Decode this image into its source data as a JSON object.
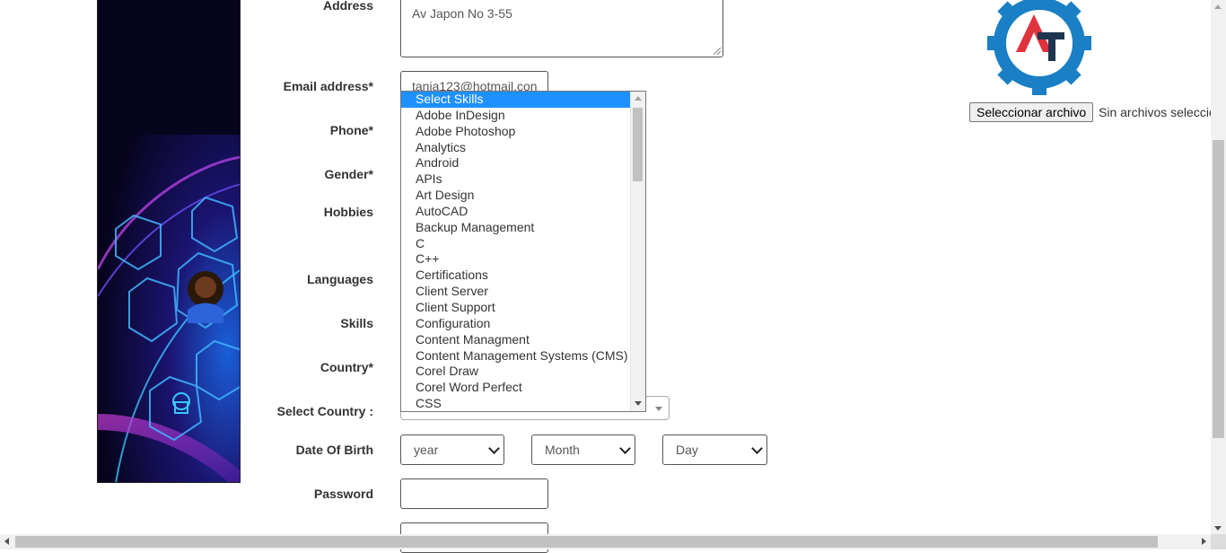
{
  "form": {
    "labels": {
      "address": "Address",
      "email": "Email address*",
      "phone": "Phone*",
      "gender": "Gender*",
      "hobbies": "Hobbies",
      "languages": "Languages",
      "skills": "Skills",
      "country": "Country*",
      "select_country": "Select Country :",
      "dob": "Date Of Birth",
      "password": "Password"
    },
    "address_value": "Av Japon No 3-55",
    "email_value": "tania123@hotmail.con",
    "dob": {
      "year": "year",
      "month": "Month",
      "day": "Day"
    }
  },
  "skills_dropdown": {
    "selected": "Select Skills",
    "options": [
      "Select Skills",
      "Adobe InDesign",
      "Adobe Photoshop",
      "Analytics",
      "Android",
      "APIs",
      "Art Design",
      "AutoCAD",
      "Backup Management",
      "C",
      "C++",
      "Certifications",
      "Client Server",
      "Client Support",
      "Configuration",
      "Content Managment",
      "Content Management Systems (CMS)",
      "Corel Draw",
      "Corel Word Perfect",
      "CSS"
    ]
  },
  "upload": {
    "button_label": "Seleccionar archivo",
    "status_text": "Sin archivos seleccionados"
  },
  "colors": {
    "selected_option": "#1e90ff",
    "logo_blue": "#1a7fc4",
    "logo_red": "#e0323c",
    "logo_dark": "#1e3550"
  }
}
